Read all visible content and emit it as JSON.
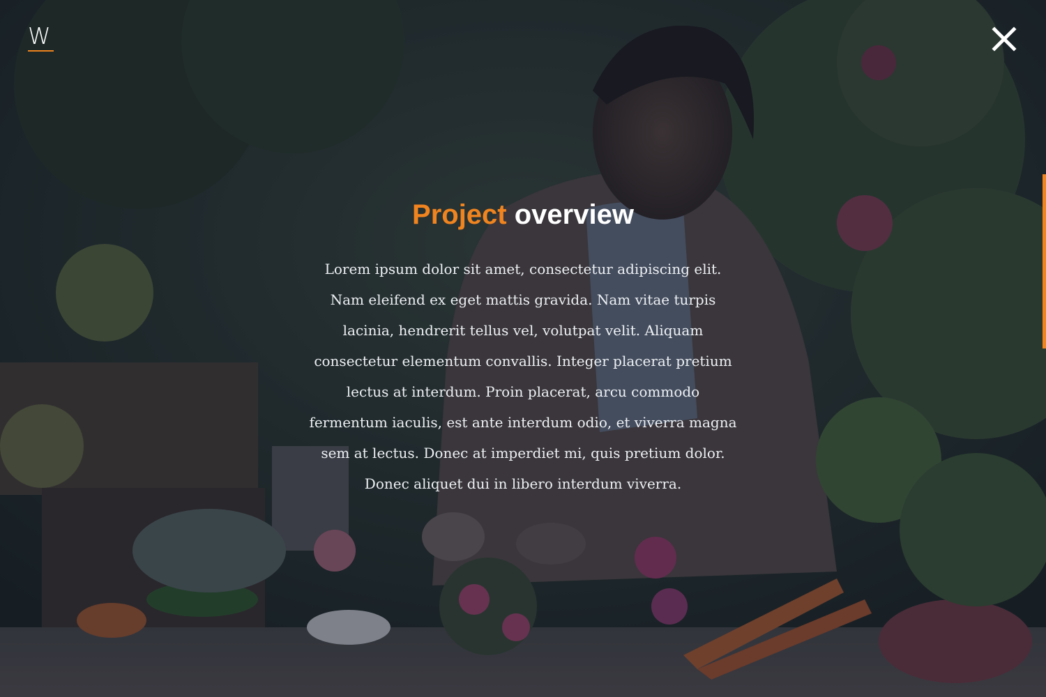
{
  "header": {
    "logo_letter": "W"
  },
  "overlay": {
    "title_accent": "Project",
    "title_rest": "overview",
    "body": "Lorem ipsum dolor sit amet, consectetur adipiscing elit. Nam eleifend ex eget mattis gravida. Nam vitae turpis lacinia, hendrerit tellus vel, volutpat velit. Aliquam consectetur elementum convallis. Integer placerat pretium lectus at interdum. Proin placerat, arcu commodo fermentum iaculis, est ante interdum odio, et viverra magna sem at lectus. Donec at imperdiet mi, quis pretium dolor. Donec aliquet dui in libero interdum viverra."
  },
  "icons": {
    "close": "close-icon"
  },
  "colors": {
    "accent": "#f0841f",
    "text": "#ffffff",
    "overlay": "#161e30"
  }
}
